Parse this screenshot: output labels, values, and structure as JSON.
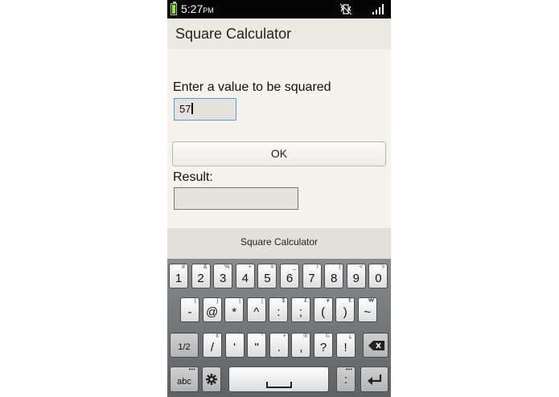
{
  "status_bar": {
    "time": "5:27",
    "ampm": "PM"
  },
  "app": {
    "title": "Square Calculator"
  },
  "form": {
    "prompt": "Enter a value to be squared",
    "input_value": "57",
    "ok_label": "OK",
    "result_label": "Result:",
    "result_value": ""
  },
  "keyboard": {
    "header": "Square Calculator",
    "row1": [
      {
        "main": "1",
        "sup": "#"
      },
      {
        "main": "2",
        "sup": "&"
      },
      {
        "main": "3",
        "sup": "%"
      },
      {
        "main": "4",
        "sup": "+"
      },
      {
        "main": "5",
        "sup": "="
      },
      {
        "main": "6",
        "sup": "_"
      },
      {
        "main": "7",
        "sup": "\\"
      },
      {
        "main": "8",
        "sup": "|"
      },
      {
        "main": "9",
        "sup": "<"
      },
      {
        "main": "0",
        "sup": ">"
      }
    ],
    "row2": [
      {
        "main": "-",
        "sup": "{"
      },
      {
        "main": "@",
        "sup": "}"
      },
      {
        "main": "*",
        "sup": "["
      },
      {
        "main": "^",
        "sup": "]"
      },
      {
        "main": ":",
        "sup": "$"
      },
      {
        "main": ";",
        "sup": "£"
      },
      {
        "main": "(",
        "sup": "¥"
      },
      {
        "main": ")",
        "sup": "€"
      },
      {
        "main": "~",
        "sup": "₩"
      }
    ],
    "row3_left": "1/2",
    "row3": [
      {
        "main": "/",
        "sup": "¢"
      },
      {
        "main": "'",
        "sup": "`"
      },
      {
        "main": "\"",
        "sup": "°"
      },
      {
        "main": ".",
        "sup": "•"
      },
      {
        "main": ",",
        "sup": "®"
      },
      {
        "main": "?",
        "sup": "©"
      },
      {
        "main": "!",
        "sup": "¿"
      }
    ],
    "row4_left": "abc",
    "space_symbol": "␣"
  }
}
